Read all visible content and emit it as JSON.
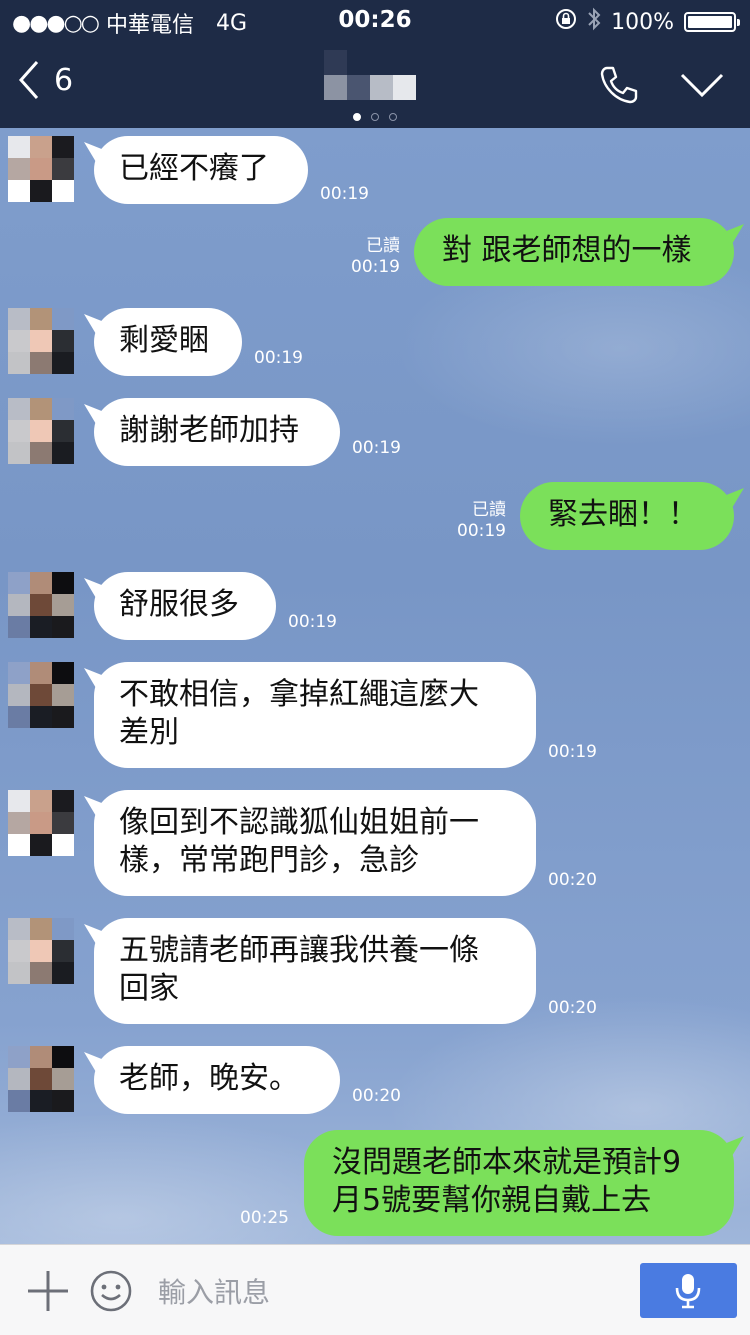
{
  "status_bar": {
    "signal_dots": "●●●○○",
    "carrier": "中華電信",
    "network": "4G",
    "time": "00:26",
    "battery_percent": "100%",
    "battery_level": 1.0
  },
  "header": {
    "back_count": "6",
    "icons": [
      "chevron-left-icon",
      "phone-icon",
      "chevron-down-icon"
    ],
    "page_indicator": {
      "pages": 3,
      "active": 0
    }
  },
  "messages": [
    {
      "side": "in",
      "text": "已經不癢了",
      "time": "00:19"
    },
    {
      "side": "out",
      "text": "對 跟老師想的一樣",
      "read": "已讀",
      "time": "00:19"
    },
    {
      "side": "in",
      "text": "剩愛睏",
      "time": "00:19"
    },
    {
      "side": "in",
      "text": "謝謝老師加持",
      "time": "00:19"
    },
    {
      "side": "out",
      "text": "緊去睏！！",
      "read": "已讀",
      "time": "00:19"
    },
    {
      "side": "in",
      "text": "舒服很多",
      "time": "00:19"
    },
    {
      "side": "in",
      "text": "不敢相信，拿掉紅繩這麼大\n差別",
      "time": "00:19"
    },
    {
      "side": "in",
      "text": "像回到不認識狐仙姐姐前一\n樣，常常跑門診，急診",
      "time": "00:20"
    },
    {
      "side": "in",
      "text": "五號請老師再讓我供養一條\n回家",
      "time": "00:20"
    },
    {
      "side": "in",
      "text": "老師，晚安。",
      "time": "00:20"
    },
    {
      "side": "out",
      "text": "沒問題老師本來就是預計9\n月5號要幫你親自戴上去",
      "time": "00:25"
    }
  ],
  "input_bar": {
    "placeholder": "輸入訊息",
    "icons": [
      "plus-icon",
      "emoji-icon",
      "microphone-icon"
    ]
  },
  "colors": {
    "header_bg": "#1e2b46",
    "outgoing_bubble": "#7be05a",
    "incoming_bubble": "#ffffff",
    "mic_button": "#4a7be1"
  }
}
